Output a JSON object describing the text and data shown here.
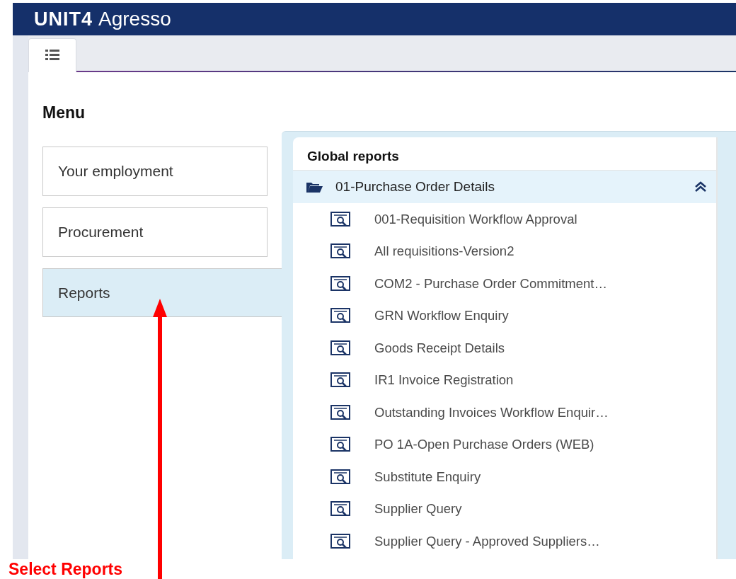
{
  "app": {
    "logo_mark": "UNIT4",
    "logo_name": "Agresso"
  },
  "tabs": [
    {
      "kind": "menu",
      "selected": true
    }
  ],
  "menu": {
    "title": "Menu",
    "items": [
      {
        "label": "Your employment",
        "selected": false
      },
      {
        "label": "Procurement",
        "selected": false
      },
      {
        "label": "Reports",
        "selected": true
      }
    ]
  },
  "reports": {
    "title": "Global reports",
    "folders": [
      {
        "label": "01-Purchase Order Details",
        "expanded": true,
        "children": [
          {
            "label": "001-Requisition Workflow Approval"
          },
          {
            "label": "All requisitions-Version2"
          },
          {
            "label": "COM2 - Purchase Order Commitment…"
          },
          {
            "label": "GRN Workflow Enquiry"
          },
          {
            "label": "Goods Receipt Details"
          },
          {
            "label": "IR1 Invoice Registration"
          },
          {
            "label": "Outstanding Invoices Workflow Enquir…"
          },
          {
            "label": "PO 1A-Open Purchase Orders (WEB)"
          },
          {
            "label": "Substitute Enquiry"
          },
          {
            "label": "Supplier Query"
          },
          {
            "label": "Supplier Query - Approved Suppliers…"
          }
        ]
      }
    ]
  },
  "annotation": {
    "text": "Select Reports"
  }
}
